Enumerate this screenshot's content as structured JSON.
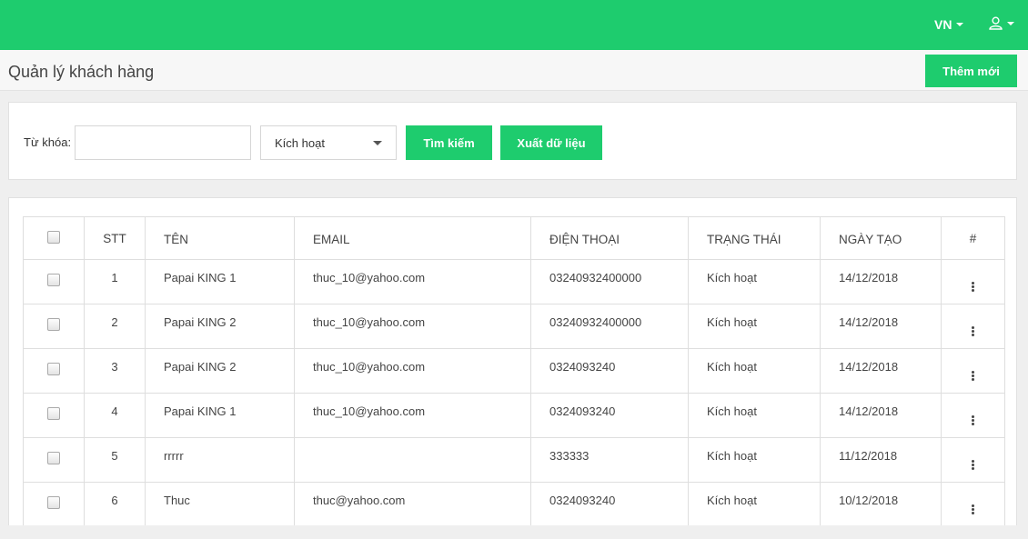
{
  "header": {
    "lang_label": "VN",
    "user_icon": "user-icon",
    "bg_color": "#1ecc6e"
  },
  "titlebar": {
    "title": "Quản lý khách hàng",
    "add_button": "Thêm mới"
  },
  "filter": {
    "keyword_label": "Từ khóa:",
    "keyword_value": "",
    "status_selected": "Kích hoạt",
    "search_button": "Tìm kiếm",
    "export_button": "Xuất dữ liệu"
  },
  "table": {
    "columns": {
      "stt": "STT",
      "name": "TÊN",
      "email": "EMAIL",
      "phone": "ĐIỆN THOẠI",
      "status": "TRẠNG THÁI",
      "created": "NGÀY TẠO",
      "actions": "#"
    },
    "rows": [
      {
        "stt": "1",
        "name": "Papai KING 1",
        "email": "thuc_10@yahoo.com",
        "phone": "03240932400000",
        "status": "Kích hoạt",
        "created": "14/12/2018"
      },
      {
        "stt": "2",
        "name": "Papai KING 2",
        "email": "thuc_10@yahoo.com",
        "phone": "03240932400000",
        "status": "Kích hoạt",
        "created": "14/12/2018"
      },
      {
        "stt": "3",
        "name": "Papai KING 2",
        "email": "thuc_10@yahoo.com",
        "phone": "0324093240",
        "status": "Kích hoạt",
        "created": "14/12/2018"
      },
      {
        "stt": "4",
        "name": "Papai KING 1",
        "email": "thuc_10@yahoo.com",
        "phone": "0324093240",
        "status": "Kích hoạt",
        "created": "14/12/2018"
      },
      {
        "stt": "5",
        "name": "rrrrr",
        "email": "",
        "phone": "333333",
        "status": "Kích hoạt",
        "created": "11/12/2018"
      },
      {
        "stt": "6",
        "name": "Thuc",
        "email": "thuc@yahoo.com",
        "phone": "0324093240",
        "status": "Kích hoạt",
        "created": "10/12/2018"
      }
    ]
  }
}
